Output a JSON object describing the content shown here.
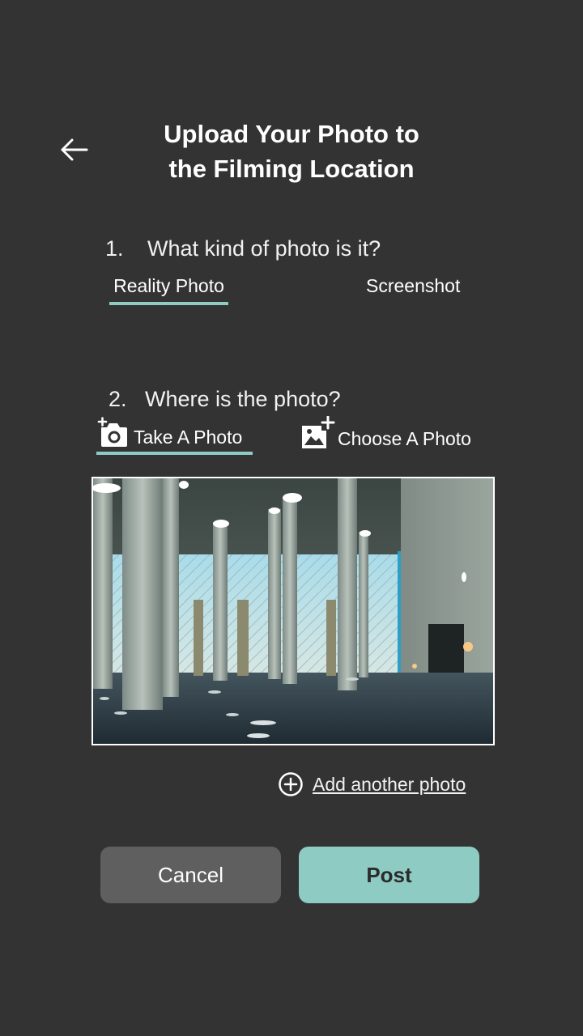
{
  "header": {
    "title_line1": "Upload Your Photo to",
    "title_line2": "the Filming Location",
    "back_icon": "arrow-left-icon"
  },
  "question1": {
    "number": "1.",
    "text": "What kind of photo is it?",
    "options": [
      {
        "label": "Reality Photo",
        "selected": true
      },
      {
        "label": "Screenshot",
        "selected": false
      }
    ]
  },
  "question2": {
    "number": "2.",
    "text": "Where is the photo?",
    "options": [
      {
        "label": "Take A Photo",
        "icon": "camera-add-icon",
        "selected": true
      },
      {
        "label": "Choose A Photo",
        "icon": "image-add-icon",
        "selected": false
      }
    ]
  },
  "add_photo": {
    "label": "Add another photo",
    "icon": "plus-circle-icon"
  },
  "actions": {
    "cancel_label": "Cancel",
    "post_label": "Post"
  },
  "colors": {
    "background": "#333333",
    "accent": "#8ecbc2",
    "cancel_button": "#5f5f5f"
  }
}
